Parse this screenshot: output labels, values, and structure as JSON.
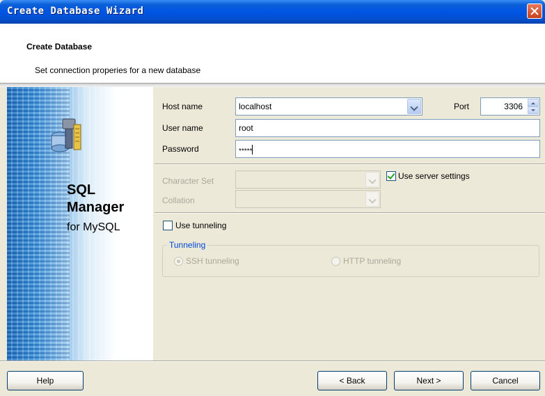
{
  "window": {
    "title": "Create Database Wizard"
  },
  "header": {
    "title": "Create Database",
    "subtitle": "Set connection properies for a new database"
  },
  "banner": {
    "line1": "SQL",
    "line2": "Manager",
    "line3": "for MySQL"
  },
  "form": {
    "host_label": "Host name",
    "host_value": "localhost",
    "port_label": "Port",
    "port_value": "3306",
    "user_label": "User name",
    "user_value": "root",
    "password_label": "Password",
    "password_value": "*****",
    "charset_label": "Character Set",
    "collation_label": "Collation",
    "use_server_settings_label": "Use server settings",
    "use_server_settings_checked": true,
    "use_tunneling_label": "Use tunneling",
    "use_tunneling_checked": false,
    "tunneling_group_title": "Tunneling",
    "ssh_label": "SSH tunneling",
    "http_label": "HTTP tunneling",
    "selected_tunnel": "SSH tunneling"
  },
  "buttons": {
    "help": "Help",
    "back": "< Back",
    "next": "Next >",
    "cancel": "Cancel"
  }
}
